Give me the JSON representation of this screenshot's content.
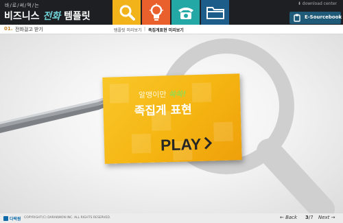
{
  "header": {
    "subtitle": "바/로/써/먹/는",
    "title_part1": "비즈니스 ",
    "title_highlight": "전화",
    "title_part2": " 템플릿",
    "nav": [
      {
        "icon": "magnifier-icon",
        "color": "#f2b21a"
      },
      {
        "icon": "lightbulb-icon",
        "color": "#e9602c"
      },
      {
        "icon": "telephone-icon",
        "color": "#23a8a5"
      },
      {
        "icon": "folder-icon",
        "color": "#1c5d8a"
      }
    ],
    "download_label": "download center",
    "esourcebook_label": "E-Sourcebook"
  },
  "breadcrumb": {
    "lesson_number": "01.",
    "lesson_title": "전화걸고 받기",
    "crumb": "템플릿 미리보기",
    "separator": "|",
    "current": "족집게표현 미리보기"
  },
  "card": {
    "tag_prefix": "알맹이만 ",
    "tag_highlight": "쏙쏙!",
    "title": "족집게 표현",
    "play_label": "PLAY"
  },
  "footer": {
    "logo_text": "다락원",
    "copyright": "COPYRIGHT(C) DARAKWON INC. ALL RIGHTS RESERVED.",
    "back_label": "Back",
    "current_page": "3",
    "page_separator": "/",
    "total_pages": "7",
    "next_label": "Next"
  },
  "colors": {
    "header_bg": "#1d1f22",
    "card_yellow": "#f5b512",
    "accent_orange": "#c6832a"
  }
}
